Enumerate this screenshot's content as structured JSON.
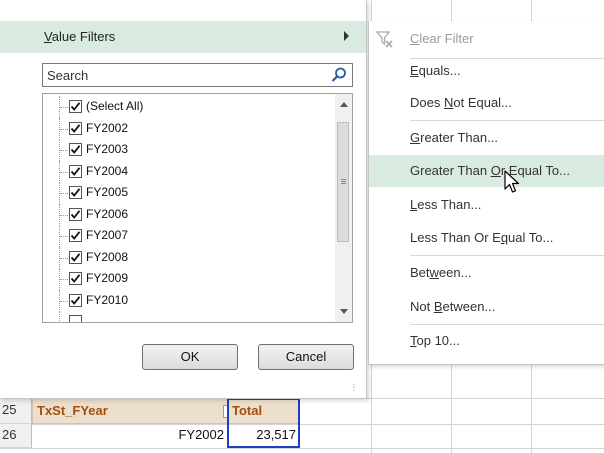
{
  "value_filters": {
    "label": "Value Filters",
    "underline_char": "V"
  },
  "search": {
    "placeholder": "Search"
  },
  "filter_items": [
    {
      "label": "(Select All)",
      "checked": true
    },
    {
      "label": "FY2002",
      "checked": true
    },
    {
      "label": "FY2003",
      "checked": true
    },
    {
      "label": "FY2004",
      "checked": true
    },
    {
      "label": "FY2005",
      "checked": true
    },
    {
      "label": "FY2006",
      "checked": true
    },
    {
      "label": "FY2007",
      "checked": true
    },
    {
      "label": "FY2008",
      "checked": true
    },
    {
      "label": "FY2009",
      "checked": true
    },
    {
      "label": "FY2010",
      "checked": true
    }
  ],
  "buttons": {
    "ok": "OK",
    "cancel": "Cancel"
  },
  "submenu": {
    "clear_filter": "Clear Filter",
    "items": [
      {
        "pre": "",
        "u": "E",
        "post": "quals..."
      },
      {
        "pre": "Does ",
        "u": "N",
        "post": "ot Equal..."
      },
      {
        "pre": "",
        "u": "G",
        "post": "reater Than..."
      },
      {
        "pre": "Greater Than ",
        "u": "O",
        "post": "r Equal To..."
      },
      {
        "pre": "",
        "u": "L",
        "post": "ess Than..."
      },
      {
        "pre": "Less Than Or E",
        "u": "q",
        "post": "ual To..."
      },
      {
        "pre": "Bet",
        "u": "w",
        "post": "een..."
      },
      {
        "pre": "Not ",
        "u": "B",
        "post": "etween..."
      },
      {
        "pre": "",
        "u": "T",
        "post": "op 10..."
      }
    ],
    "hovered_index": 3
  },
  "pivot": {
    "row_25": "25",
    "row_26": "26",
    "field_header": "TxSt_FYear",
    "total_header": "Total",
    "first_year": "FY2002",
    "first_total": "23,517"
  },
  "colors": {
    "hover": "#d9ebe0",
    "header_fill": "#eddfcd",
    "header_text": "#a34f0d",
    "selection": "#1f3fbf"
  }
}
